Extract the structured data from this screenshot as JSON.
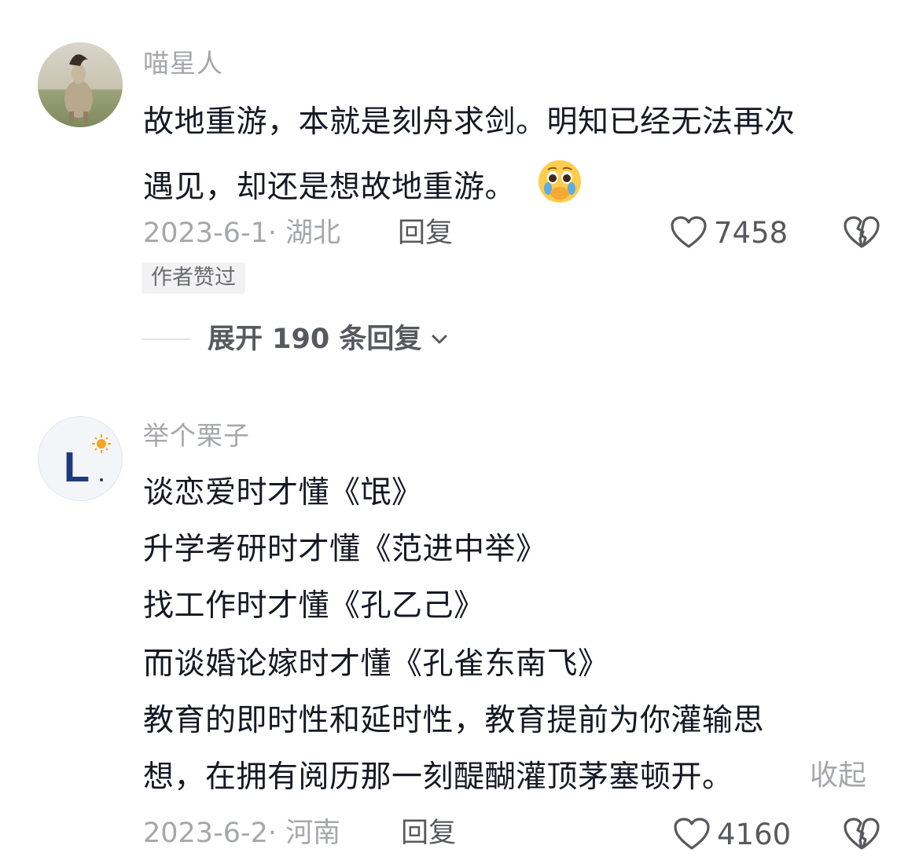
{
  "comments": [
    {
      "username": "喵星人",
      "text_lines": [
        "故地重游，本就是刻舟求剑。明知已经无法再次",
        "遇见，却还是想故地重游。"
      ],
      "emoji": "🥹",
      "date_location": "2023-6-1· 湖北",
      "reply_label": "回复",
      "likes": "7458",
      "author_badge": "作者赞过",
      "expand_label": "展开 190 条回复"
    },
    {
      "username": "举个栗子",
      "avatar_letter": "L",
      "text_lines": [
        "谈恋爱时才懂《氓》",
        "升学考研时才懂《范进中举》",
        "找工作时才懂《孔乙己》",
        "而谈婚论嫁时才懂《孔雀东南飞》",
        "教育的即时性和延时性，教育提前为你灌输思",
        "想，在拥有阅历那一刻醍醐灌顶茅塞顿开。"
      ],
      "collapse_label": "收起",
      "date_location": "2023-6-2· 河南",
      "reply_label": "回复",
      "likes": "4160"
    }
  ],
  "colors": {
    "username": "#a6a7ab",
    "text": "#161823",
    "secondary": "#58595e"
  },
  "icons": [
    "heart-outline-icon",
    "broken-heart-icon",
    "chevron-down-icon",
    "crying-emoji-icon"
  ]
}
